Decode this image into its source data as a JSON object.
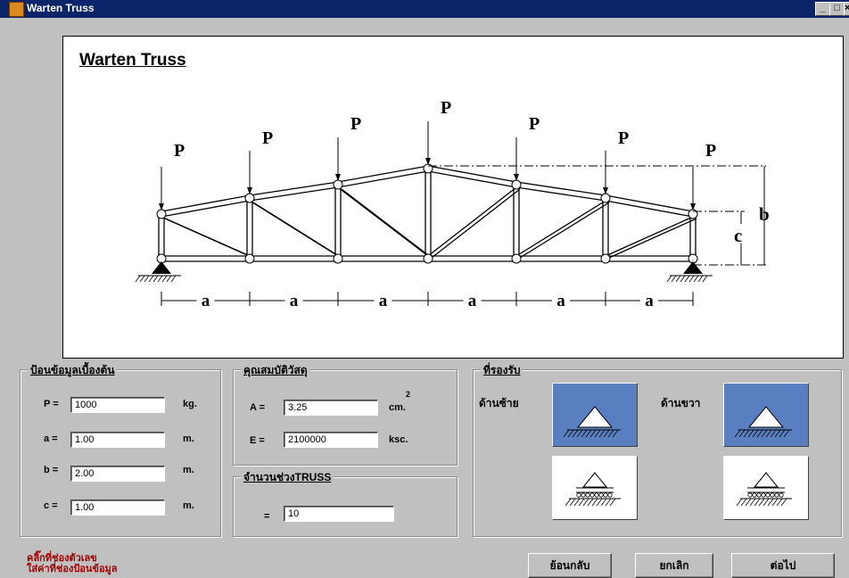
{
  "window": {
    "title": "Warten Truss",
    "min_label": "_",
    "max_label": "□",
    "close_label": "×"
  },
  "drawing": {
    "title": "Warten Truss",
    "load_label": "P",
    "span_label": "a",
    "dim_b_label": "b",
    "dim_c_label": "c"
  },
  "basic_input": {
    "group_label": "ป้อนข้อมูลเบื้องต้น",
    "fields": [
      {
        "name": "P =",
        "value": "1000",
        "unit": "kg."
      },
      {
        "name": "a =",
        "value": "1.00",
        "unit": "m."
      },
      {
        "name": "b =",
        "value": "2.00",
        "unit": "m."
      },
      {
        "name": "c =",
        "value": "1.00",
        "unit": "m."
      }
    ]
  },
  "material": {
    "group_label": "คุณสมบัติวัสดุ",
    "fields": [
      {
        "name": "A =",
        "value": "3.25",
        "unit": "cm.",
        "sup": "2"
      },
      {
        "name": "E =",
        "value": "2100000",
        "unit": "ksc."
      }
    ]
  },
  "spans": {
    "group_label": "จำนวนช่วงTRUSS",
    "name": "=",
    "value": "10"
  },
  "supports": {
    "group_label": "ที่รองรับ",
    "left_label": "ด้านซ้าย",
    "right_label": "ด้านขวา"
  },
  "hint": {
    "line1": "คลิ๊กที่ช่องตัวเลข",
    "line2": "ใส่ค่าที่ช่องป้อนข้อมูล"
  },
  "buttons": {
    "back": "ย้อนกลับ",
    "cancel": "ยกเลิก",
    "next": "ต่อไป"
  }
}
